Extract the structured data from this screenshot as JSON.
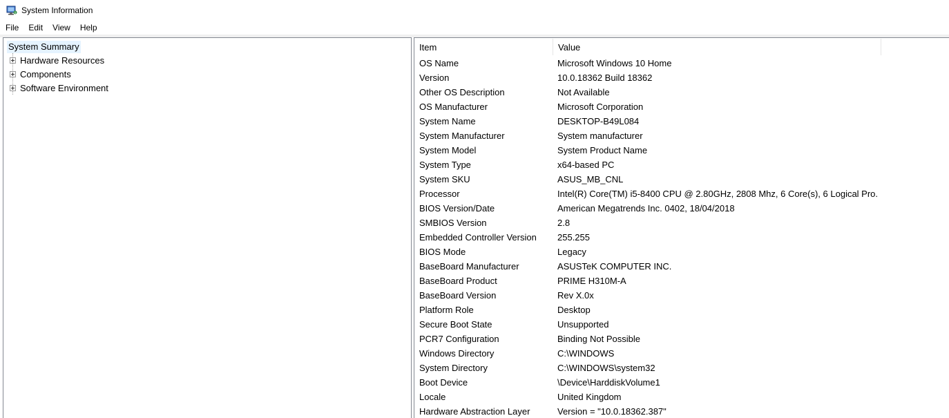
{
  "window": {
    "title": "System Information",
    "icon": "system-information-icon"
  },
  "menu": {
    "file": "File",
    "edit": "Edit",
    "view": "View",
    "help": "Help"
  },
  "tree": {
    "root": "System Summary",
    "children": [
      {
        "label": "Hardware Resources"
      },
      {
        "label": "Components"
      },
      {
        "label": "Software Environment"
      }
    ]
  },
  "list": {
    "columns": {
      "item": "Item",
      "value": "Value"
    },
    "rows": [
      {
        "item": "OS Name",
        "value": "Microsoft Windows 10 Home"
      },
      {
        "item": "Version",
        "value": "10.0.18362 Build 18362"
      },
      {
        "item": "Other OS Description",
        "value": "Not Available"
      },
      {
        "item": "OS Manufacturer",
        "value": "Microsoft Corporation"
      },
      {
        "item": "System Name",
        "value": "DESKTOP-B49L084"
      },
      {
        "item": "System Manufacturer",
        "value": "System manufacturer"
      },
      {
        "item": "System Model",
        "value": "System Product Name"
      },
      {
        "item": "System Type",
        "value": "x64-based PC"
      },
      {
        "item": "System SKU",
        "value": "ASUS_MB_CNL"
      },
      {
        "item": "Processor",
        "value": "Intel(R) Core(TM) i5-8400 CPU @ 2.80GHz, 2808 Mhz, 6 Core(s), 6 Logical Pro..."
      },
      {
        "item": "BIOS Version/Date",
        "value": "American Megatrends Inc. 0402, 18/04/2018"
      },
      {
        "item": "SMBIOS Version",
        "value": "2.8"
      },
      {
        "item": "Embedded Controller Version",
        "value": "255.255"
      },
      {
        "item": "BIOS Mode",
        "value": "Legacy"
      },
      {
        "item": "BaseBoard Manufacturer",
        "value": "ASUSTeK COMPUTER INC."
      },
      {
        "item": "BaseBoard Product",
        "value": "PRIME H310M-A"
      },
      {
        "item": "BaseBoard Version",
        "value": "Rev X.0x"
      },
      {
        "item": "Platform Role",
        "value": "Desktop"
      },
      {
        "item": "Secure Boot State",
        "value": "Unsupported"
      },
      {
        "item": "PCR7 Configuration",
        "value": "Binding Not Possible"
      },
      {
        "item": "Windows Directory",
        "value": "C:\\WINDOWS"
      },
      {
        "item": "System Directory",
        "value": "C:\\WINDOWS\\system32"
      },
      {
        "item": "Boot Device",
        "value": "\\Device\\HarddiskVolume1"
      },
      {
        "item": "Locale",
        "value": "United Kingdom"
      },
      {
        "item": "Hardware Abstraction Layer",
        "value": "Version = \"10.0.18362.387\""
      }
    ]
  }
}
